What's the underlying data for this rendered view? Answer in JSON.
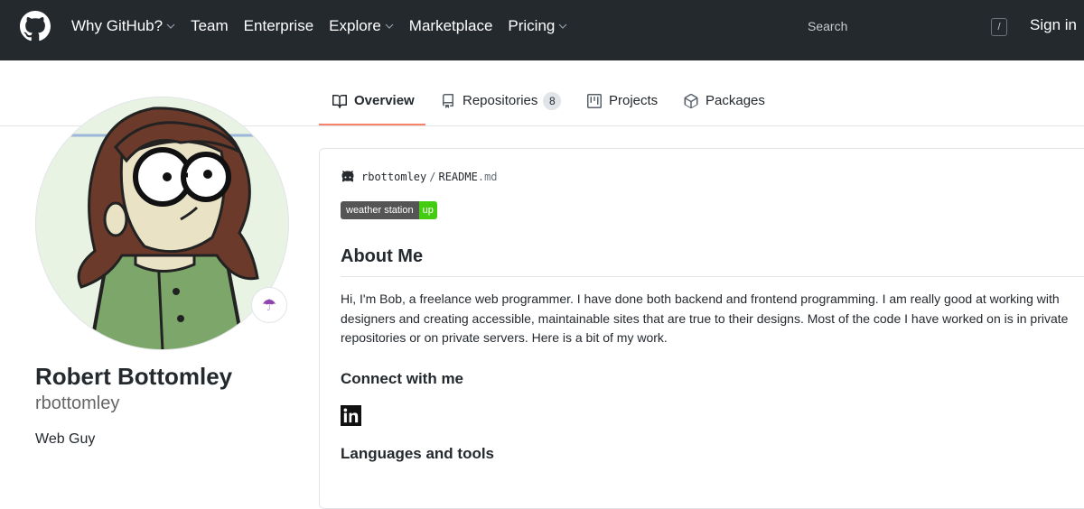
{
  "header": {
    "nav": [
      {
        "label": "Why GitHub?",
        "has_dropdown": true
      },
      {
        "label": "Team",
        "has_dropdown": false
      },
      {
        "label": "Enterprise",
        "has_dropdown": false
      },
      {
        "label": "Explore",
        "has_dropdown": true
      },
      {
        "label": "Marketplace",
        "has_dropdown": false
      },
      {
        "label": "Pricing",
        "has_dropdown": true
      }
    ],
    "search_placeholder": "Search",
    "search_shortcut": "/",
    "signin": "Sign in",
    "background": "#24292e"
  },
  "tabs": [
    {
      "label": "Overview",
      "icon": "book-icon",
      "active": true
    },
    {
      "label": "Repositories",
      "icon": "repo-icon",
      "count": "8"
    },
    {
      "label": "Projects",
      "icon": "project-icon"
    },
    {
      "label": "Packages",
      "icon": "package-icon"
    }
  ],
  "profile": {
    "fullname": "Robert Bottomley",
    "username": "rbottomley",
    "bio": "Web Guy",
    "status_emoji": "☂"
  },
  "readme": {
    "owner": "rbottomley",
    "separator": "/",
    "file": "README",
    "ext": ".md",
    "badge_left": "weather station",
    "badge_right": "up",
    "about_heading": "About Me",
    "about_text": "Hi, I'm Bob, a freelance web programmer. I have done both backend and frontend programming. I am really good at working with designers and creating accessible, maintainable sites that are true to their designs. Most of the code I have worked on is in private repositories or on private servers. Here is a bit of my work.",
    "connect_heading": "Connect with me",
    "languages_heading": "Languages and tools"
  },
  "colors": {
    "accent_tab": "#f9826c",
    "badge_green": "#44cc11",
    "badge_gray": "#555555"
  }
}
